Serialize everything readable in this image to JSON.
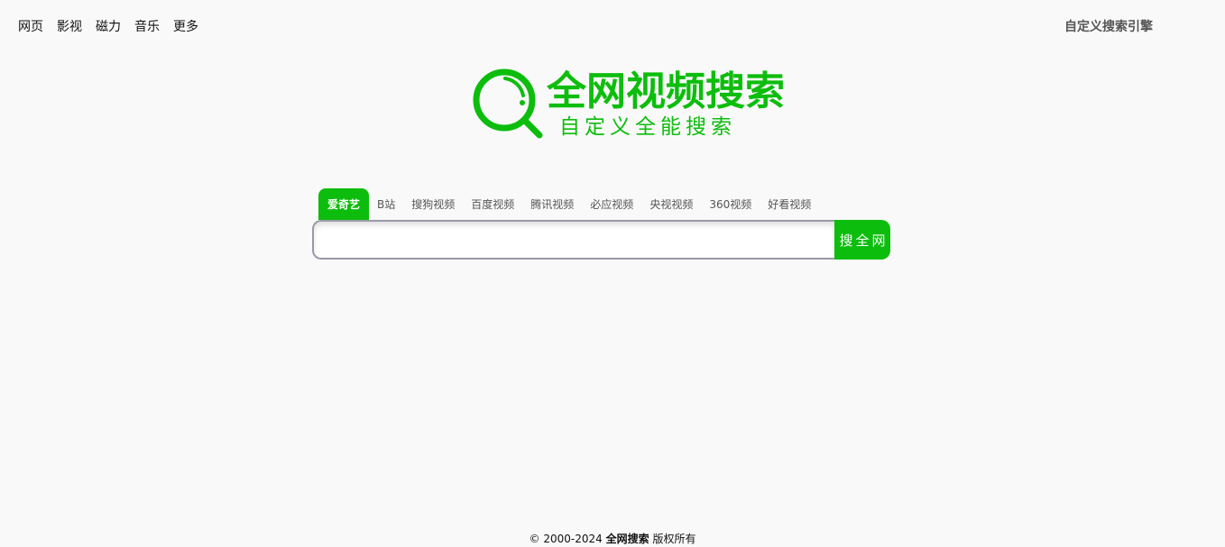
{
  "topnav": {
    "items": [
      "网页",
      "影视",
      "磁力",
      "音乐",
      "更多"
    ]
  },
  "custom_engine_label": "自定义搜索引擎",
  "logo": {
    "title": "全网视频搜索",
    "subtitle": "自定义全能搜索",
    "icon": "search-magnifier-icon",
    "color": "#0dbd0d"
  },
  "tabs": {
    "items": [
      "爱奇艺",
      "B站",
      "搜狗视频",
      "百度视频",
      "腾讯视频",
      "必应视频",
      "央视视频",
      "360视频",
      "好看视频"
    ],
    "active_index": 0
  },
  "search": {
    "value": "",
    "placeholder": "",
    "button_label": "搜全网"
  },
  "footer": {
    "copyright": "© 2000-2024",
    "brand": "全网搜索",
    "rights": "版权所有"
  },
  "colors": {
    "accent": "#0dbd0d",
    "background": "#f9f9f9"
  }
}
